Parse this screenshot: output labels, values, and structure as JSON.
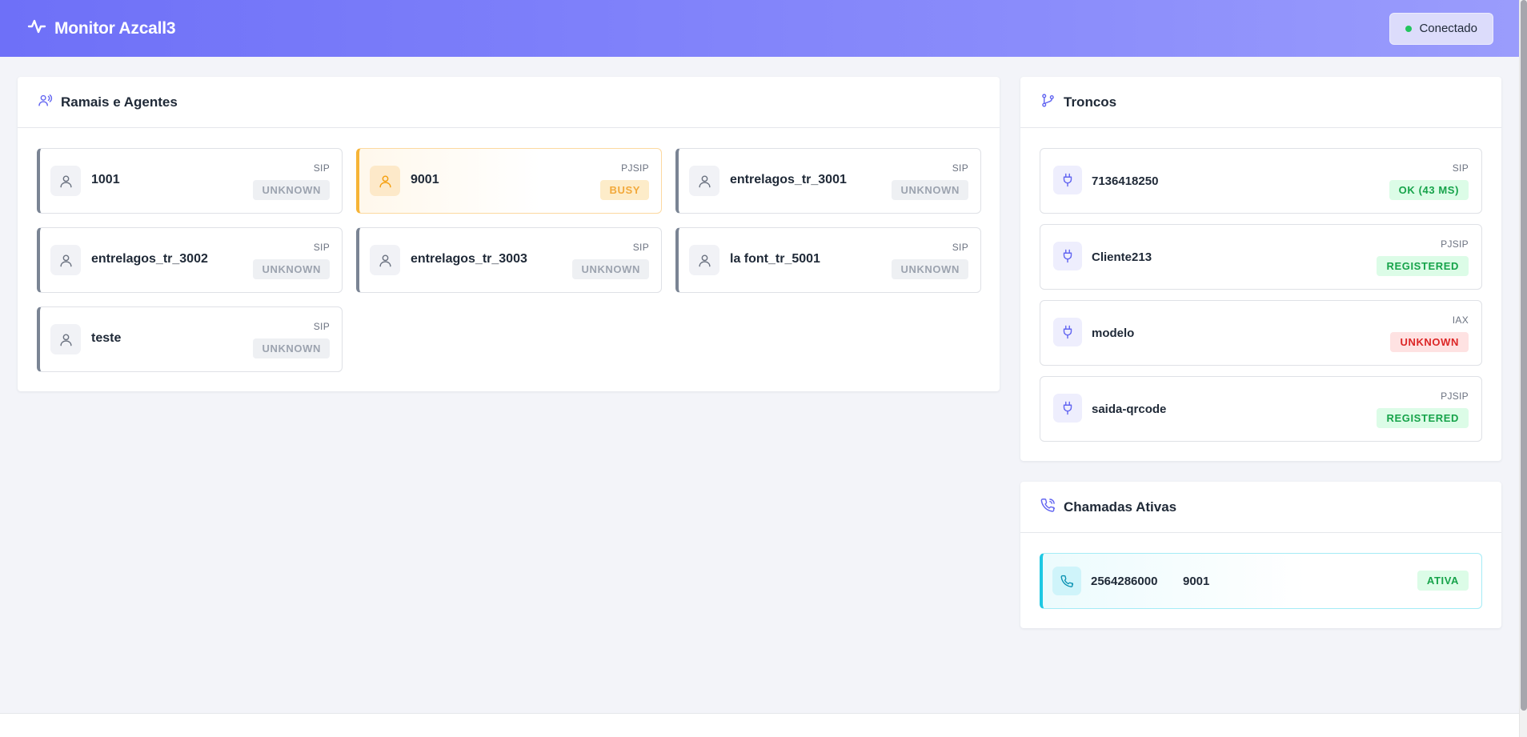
{
  "header": {
    "app_title": "Monitor Azcall3",
    "connection_status": "Conectado",
    "status_color": "#22c55e"
  },
  "extensions_panel": {
    "title": "Ramais e Agentes",
    "items": [
      {
        "name": "1001",
        "protocol": "SIP",
        "status": "UNKNOWN",
        "state": "unknown"
      },
      {
        "name": "9001",
        "protocol": "PJSIP",
        "status": "BUSY",
        "state": "busy"
      },
      {
        "name": "entrelagos_tr_3001",
        "protocol": "SIP",
        "status": "UNKNOWN",
        "state": "unknown"
      },
      {
        "name": "entrelagos_tr_3002",
        "protocol": "SIP",
        "status": "UNKNOWN",
        "state": "unknown"
      },
      {
        "name": "entrelagos_tr_3003",
        "protocol": "SIP",
        "status": "UNKNOWN",
        "state": "unknown"
      },
      {
        "name": "la font_tr_5001",
        "protocol": "SIP",
        "status": "UNKNOWN",
        "state": "unknown"
      },
      {
        "name": "teste",
        "protocol": "SIP",
        "status": "UNKNOWN",
        "state": "unknown"
      }
    ]
  },
  "trunks_panel": {
    "title": "Troncos",
    "items": [
      {
        "name": "7136418250",
        "protocol": "SIP",
        "status": "OK (43 MS)",
        "state": "ok"
      },
      {
        "name": "Cliente213",
        "protocol": "PJSIP",
        "status": "REGISTERED",
        "state": "ok"
      },
      {
        "name": "modelo",
        "protocol": "IAX",
        "status": "UNKNOWN",
        "state": "err"
      },
      {
        "name": "saida-qrcode",
        "protocol": "PJSIP",
        "status": "REGISTERED",
        "state": "ok"
      }
    ]
  },
  "calls_panel": {
    "title": "Chamadas Ativas",
    "items": [
      {
        "caller": "2564286000",
        "destination": "9001",
        "status": "ATIVA"
      }
    ]
  },
  "colors": {
    "header_gradient_start": "#6e70f8",
    "header_gradient_end": "#9a9cfc",
    "busy": "#f6b437",
    "ok": "#16a34a",
    "error": "#dc2626",
    "active_call": "#1ec8e3"
  }
}
